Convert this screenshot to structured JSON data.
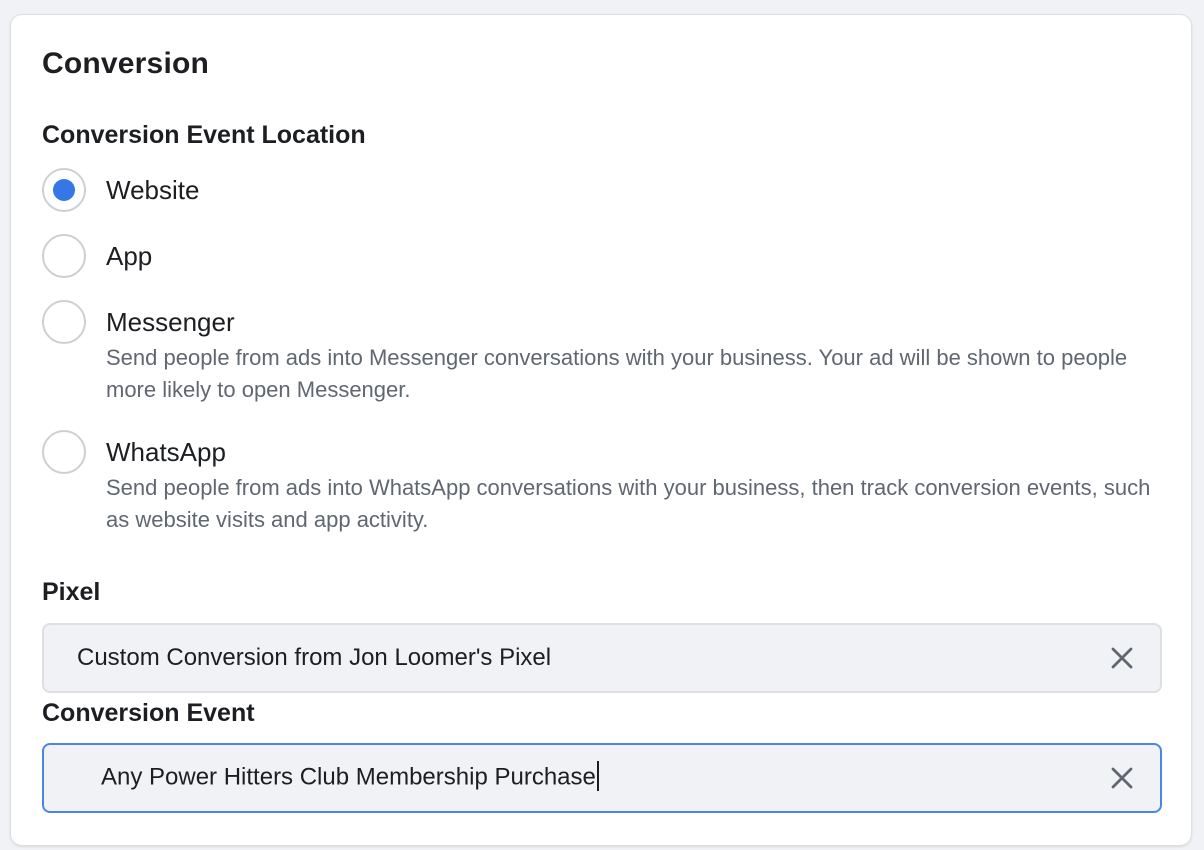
{
  "section": {
    "title": "Conversion"
  },
  "location": {
    "label": "Conversion Event Location",
    "options": [
      {
        "label": "Website",
        "description": "",
        "checked": true
      },
      {
        "label": "App",
        "description": "",
        "checked": false
      },
      {
        "label": "Messenger",
        "description": "Send people from ads into Messenger conversations with your business. Your ad will be shown to people more likely to open Messenger.",
        "checked": false
      },
      {
        "label": "WhatsApp",
        "description": "Send people from ads into WhatsApp conversations with your business, then track conversion events, such as website visits and app activity.",
        "checked": false
      }
    ]
  },
  "pixel": {
    "label": "Pixel",
    "value": "Custom Conversion from Jon Loomer's Pixel"
  },
  "conversion_event": {
    "label": "Conversion Event",
    "value": "Any Power Hitters Club Membership Purchase"
  },
  "icons": {
    "clear": "close-icon"
  },
  "colors": {
    "accent": "#3578e5",
    "focus_border": "#4a86e8",
    "text": "#1c1e21",
    "muted": "#606770"
  }
}
